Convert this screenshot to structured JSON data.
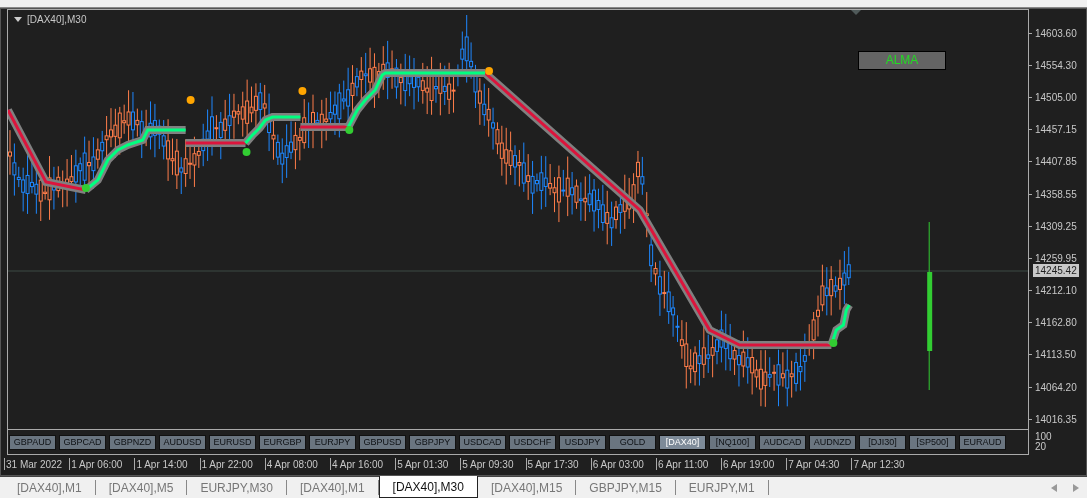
{
  "chart": {
    "title": "[DAX40],M30",
    "indicator_label": "ALMA",
    "current_price": "14245.42",
    "price_ticks": [
      "14603.60",
      "14554.30",
      "14505.00",
      "14457.15",
      "14407.85",
      "14358.55",
      "14309.25",
      "14259.95",
      "14212.10",
      "14162.80",
      "14113.50",
      "14064.20",
      "14016.35"
    ]
  },
  "symbol_buttons": [
    {
      "label": "GBPAUD",
      "selected": false
    },
    {
      "label": "GBPCAD",
      "selected": false
    },
    {
      "label": "GBPNZD",
      "selected": false
    },
    {
      "label": "AUDUSD",
      "selected": false
    },
    {
      "label": "EURUSD",
      "selected": false
    },
    {
      "label": "EURGBP",
      "selected": false
    },
    {
      "label": "EURJPY",
      "selected": false
    },
    {
      "label": "GBPUSD",
      "selected": false
    },
    {
      "label": "GBPJPY",
      "selected": false
    },
    {
      "label": "USDCAD",
      "selected": false
    },
    {
      "label": "USDCHF",
      "selected": false
    },
    {
      "label": "USDJPY",
      "selected": false
    },
    {
      "label": "GOLD",
      "selected": false
    },
    {
      "label": "[DAX40]",
      "selected": true
    },
    {
      "label": "[NQ100]",
      "selected": false
    },
    {
      "label": "AUDCAD",
      "selected": false
    },
    {
      "label": "AUDNZD",
      "selected": false
    },
    {
      "label": "[DJI30]",
      "selected": false
    },
    {
      "label": "[SP500]",
      "selected": false
    },
    {
      "label": "EURAUD",
      "selected": false
    }
  ],
  "subwindow_scale": [
    "100",
    "20"
  ],
  "time_labels": [
    "31 Mar 2022",
    "1 Apr 06:00",
    "1 Apr 14:00",
    "1 Apr 22:00",
    "4 Apr 08:00",
    "4 Apr 16:00",
    "5 Apr 01:30",
    "5 Apr 09:30",
    "5 Apr 17:30",
    "6 Apr 03:00",
    "6 Apr 11:00",
    "6 Apr 19:00",
    "7 Apr 04:30",
    "7 Apr 12:30"
  ],
  "tabs": [
    {
      "label": "[DAX40],M1",
      "selected": false
    },
    {
      "label": "[DAX40],M5",
      "selected": false
    },
    {
      "label": "EURJPY,M30",
      "selected": false
    },
    {
      "label": "[DAX40],M1",
      "selected": false
    },
    {
      "label": "[DAX40],M30",
      "selected": true
    },
    {
      "label": "[DAX40],M15",
      "selected": false
    },
    {
      "label": "GBPJPY,M15",
      "selected": false
    },
    {
      "label": "EURJPY,M1",
      "selected": false
    }
  ]
}
